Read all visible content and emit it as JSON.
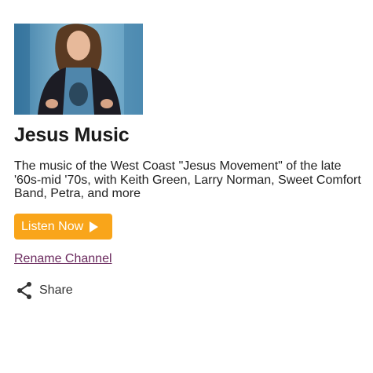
{
  "channel": {
    "title": "Jesus Music",
    "description": "The music of the West Coast \"Jesus Movement\" of the late '60s-mid '70s, with Keith Green, Larry Norman, Sweet Comfort Band, Petra, and more",
    "artwork_icon": "channel-artwork-image"
  },
  "actions": {
    "listen_label": "Listen Now",
    "rename_label": "Rename Channel",
    "share_label": "Share"
  },
  "colors": {
    "accent": "#f9a51a",
    "link": "#6b2a5e",
    "title": "#1a1a1a"
  }
}
